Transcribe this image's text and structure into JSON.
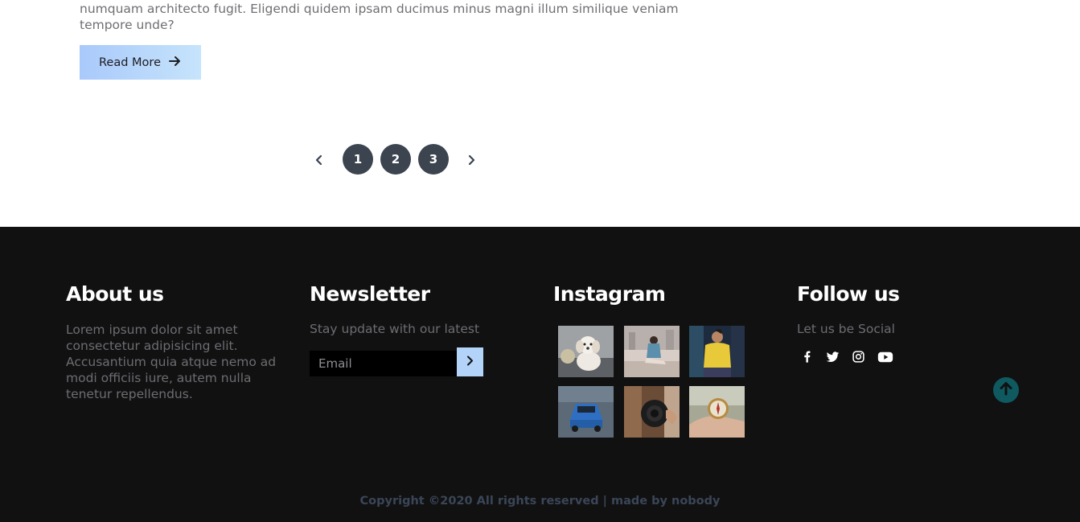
{
  "article": {
    "excerpt": "numquam architecto fugit. Eligendi quidem ipsam ducimus minus magni illum similique veniam tempore unde?",
    "read_more_label": "Read More",
    "read_more_icon": "arrow-right-icon"
  },
  "pagination": {
    "prev_icon": "chevron-left-icon",
    "next_icon": "chevron-right-icon",
    "pages": [
      "1",
      "2",
      "3"
    ]
  },
  "footer": {
    "about": {
      "title": "About us",
      "text": "Lorem ipsum dolor sit amet consectetur adipisicing elit. Accusantium quia atque nemo ad modi officiis iure, autem nulla tenetur repellendus."
    },
    "newsletter": {
      "title": "Newsletter",
      "text": "Stay update with our latest",
      "email_placeholder": "Email",
      "submit_icon": "chevron-right-icon"
    },
    "instagram": {
      "title": "Instagram",
      "photos": [
        "dog-photo",
        "woman-sitting-photo",
        "man-yellow-sweater-photo",
        "blue-car-photo",
        "camera-photo",
        "compass-photo"
      ]
    },
    "follow": {
      "title": "Follow us",
      "text": "Let us be Social",
      "icons": [
        "facebook-icon",
        "twitter-icon",
        "instagram-icon",
        "youtube-icon"
      ]
    },
    "copyright": "Copyright ©2020 All rights reserved | made by nobody"
  },
  "colors": {
    "footer_bg": "#111112",
    "pager_bg": "#3b444f",
    "accent_gradient_start": "#a9c9fb",
    "accent_gradient_end": "#c6e4fb",
    "scroll_top": "#0f5a60"
  }
}
